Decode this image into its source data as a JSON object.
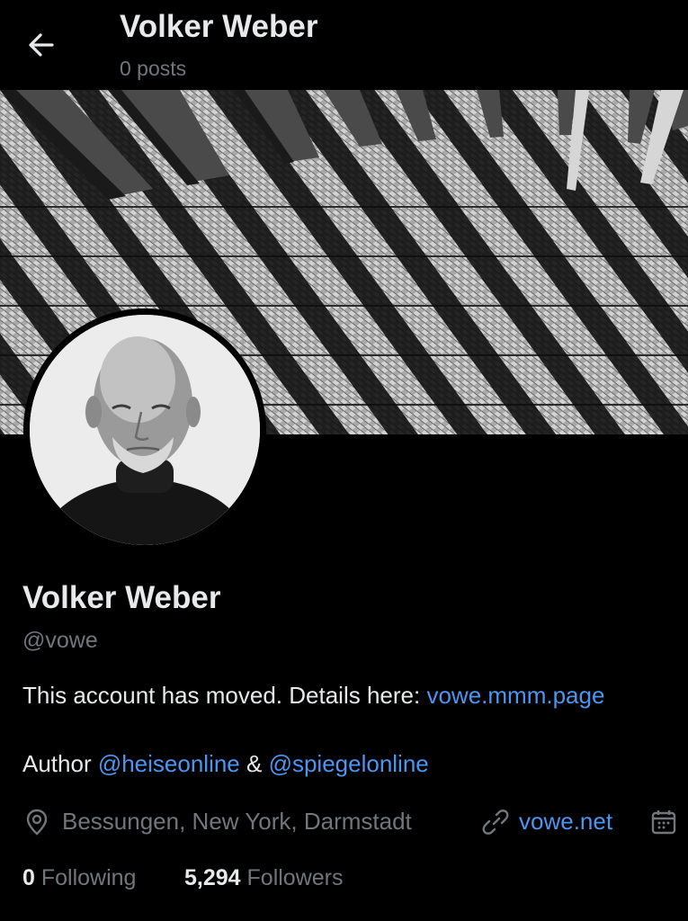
{
  "header": {
    "title": "Volker Weber",
    "post_count": "0 posts"
  },
  "profile": {
    "name": "Volker Weber",
    "handle": "@vowe",
    "bio_line1_text": "This account has moved. Details here: ",
    "bio_line1_link": "vowe.mmm.page",
    "bio_line2_prefix": "Author ",
    "bio_line2_link1": "@heiseonline",
    "bio_line2_amp": " & ",
    "bio_line2_link2": "@spiegelonline"
  },
  "meta": {
    "location": "Bessungen, New York, Darmstadt",
    "website": "vowe.net",
    "location_icon": "location-pin-icon",
    "link_icon": "link-icon",
    "calendar_icon": "calendar-icon"
  },
  "stats": {
    "following_count": "0",
    "following_label": "Following",
    "followers_count": "5,294",
    "followers_label": "Followers"
  },
  "colors": {
    "background": "#000000",
    "text_primary": "#e7e9ea",
    "text_secondary": "#71767b",
    "link": "#4c95f0"
  }
}
